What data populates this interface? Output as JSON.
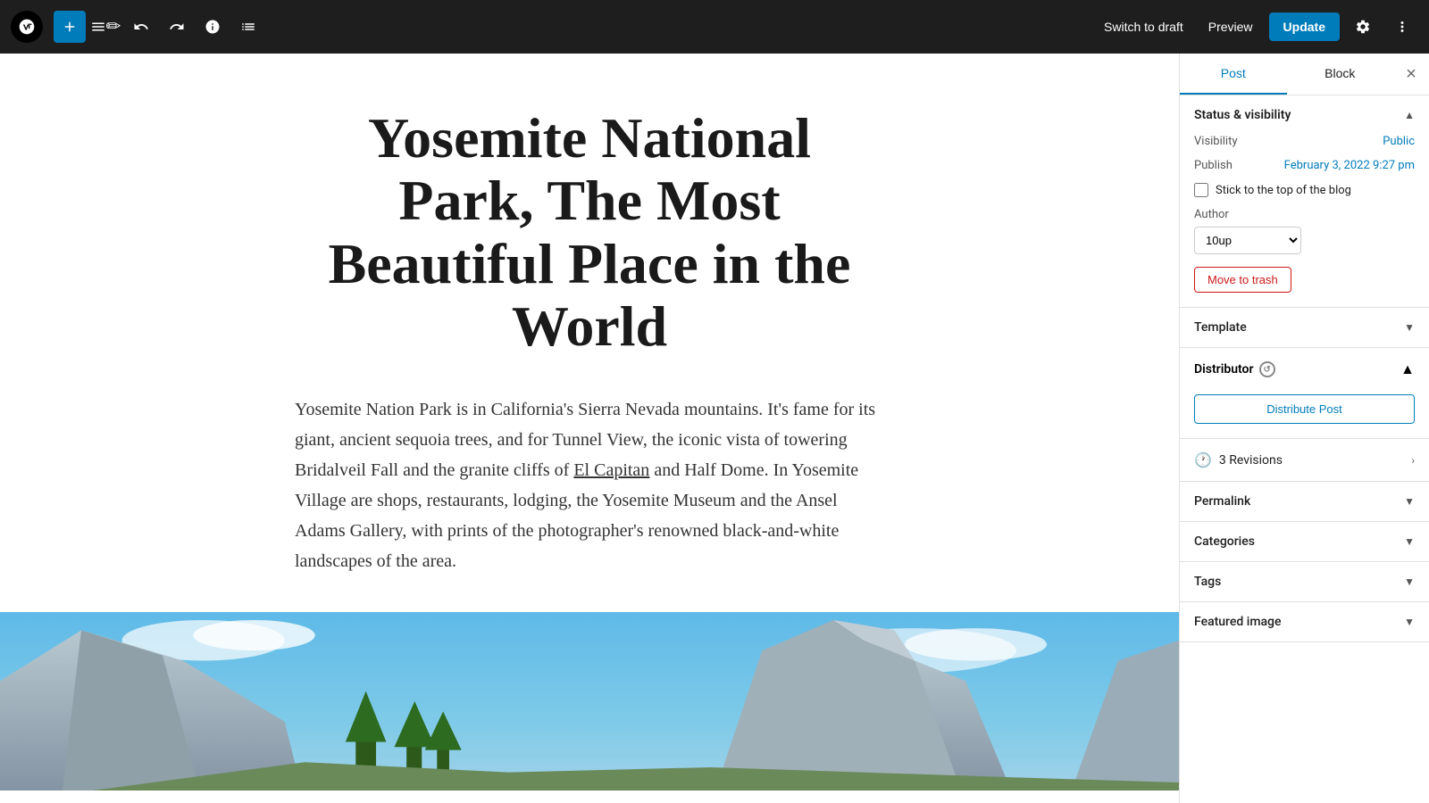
{
  "toolbar": {
    "add_label": "+",
    "wp_logo_alt": "WordPress",
    "switch_draft_label": "Switch to draft",
    "preview_label": "Preview",
    "update_label": "Update"
  },
  "post": {
    "title": "Yosemite National Park, The Most Beautiful Place in the World",
    "body": "Yosemite Nation Park is in California's Sierra Nevada mountains.  It's fame for its giant, ancient sequoia trees, and for Tunnel View, the iconic vista of towering Bridalveil Fall and the granite cliffs of El Capitan and Half Dome.  In Yosemite Village are shops, restaurants, lodging, the Yosemite Museum and the Ansel Adams Gallery, with prints of the photographer's renowned black-and-white landscapes of the area."
  },
  "sidebar": {
    "tab_post": "Post",
    "tab_block": "Block",
    "close_label": "×",
    "status_section": {
      "title": "Status & visibility",
      "visibility_label": "Visibility",
      "visibility_value": "Public",
      "publish_label": "Publish",
      "publish_value": "February 3, 2022 9:27 pm",
      "stick_label": "Stick to the top of the blog",
      "author_label": "Author",
      "author_value": "10up",
      "move_trash_label": "Move to trash"
    },
    "template_section": {
      "title": "Template"
    },
    "distributor_section": {
      "title": "Distributor",
      "distribute_btn": "Distribute Post"
    },
    "revisions": {
      "label": "3 Revisions"
    },
    "permalink_section": {
      "title": "Permalink"
    },
    "categories_section": {
      "title": "Categories"
    },
    "tags_section": {
      "title": "Tags"
    },
    "featured_image_section": {
      "title": "Featured image"
    }
  }
}
